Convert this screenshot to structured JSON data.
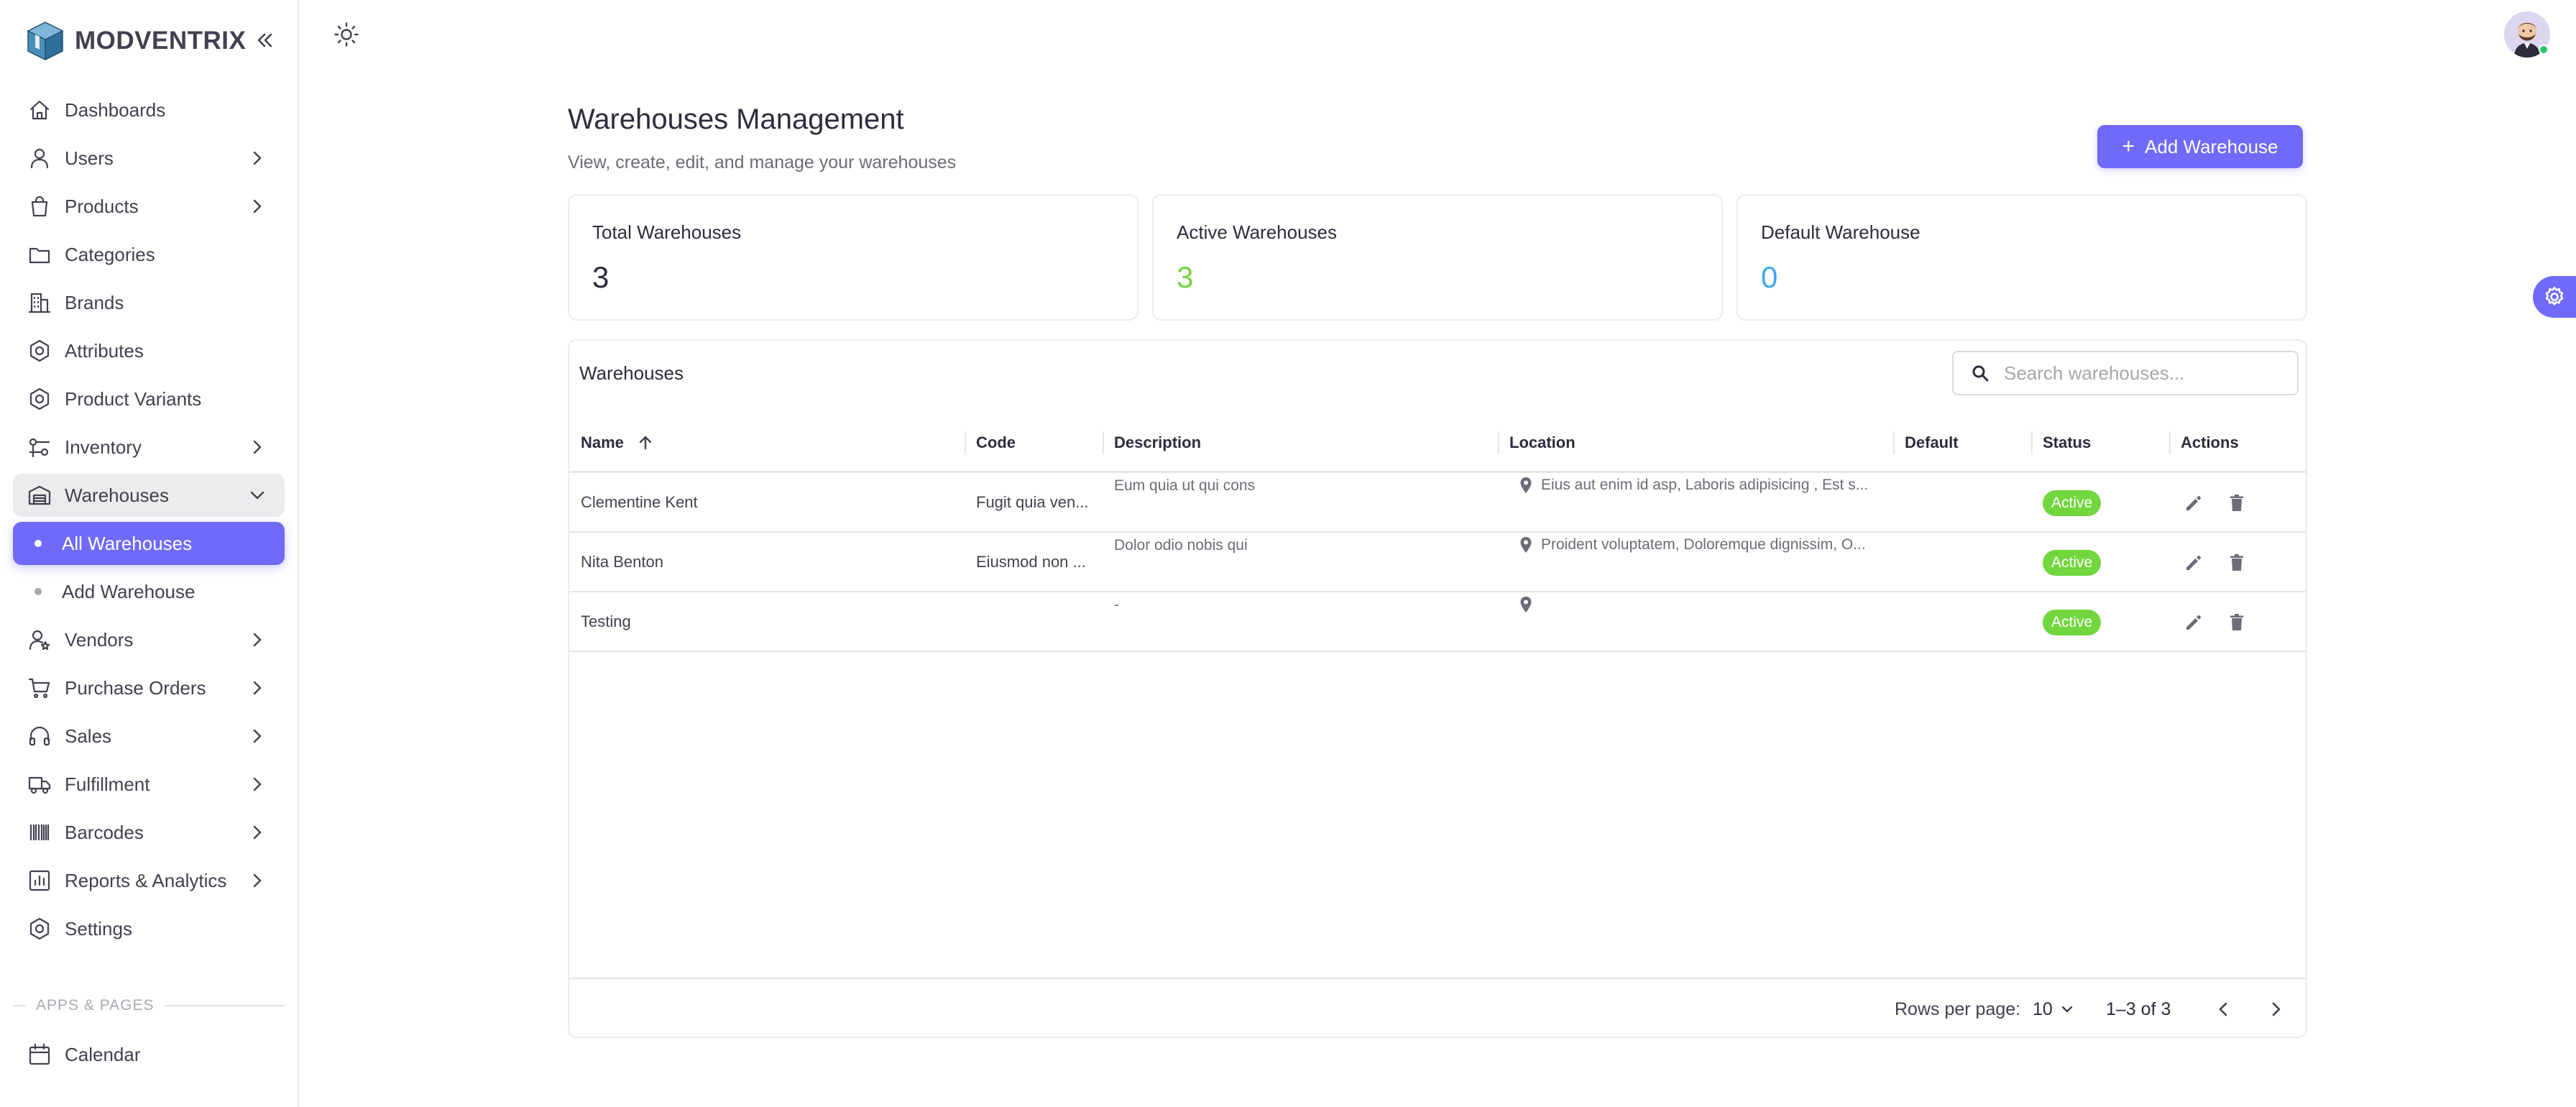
{
  "app": {
    "brand": "MODVENTRIX"
  },
  "sidebar": {
    "items": [
      {
        "label": "Dashboards",
        "icon": "home-icon"
      },
      {
        "label": "Users",
        "icon": "user-icon",
        "chevron": true
      },
      {
        "label": "Products",
        "icon": "shopping-bag-icon",
        "chevron": true
      },
      {
        "label": "Categories",
        "icon": "folder-icon"
      },
      {
        "label": "Brands",
        "icon": "building-icon"
      },
      {
        "label": "Attributes",
        "icon": "hexagon-cog-icon"
      },
      {
        "label": "Product Variants",
        "icon": "hexagon-cog-icon"
      },
      {
        "label": "Inventory",
        "icon": "inventory-icon",
        "chevron": true
      },
      {
        "label": "Warehouses",
        "icon": "warehouse-icon",
        "open": true
      },
      {
        "label": "All Warehouses",
        "sub": true,
        "active": true
      },
      {
        "label": "Add Warehouse",
        "sub": true
      },
      {
        "label": "Vendors",
        "icon": "user-star-icon",
        "chevron": true
      },
      {
        "label": "Purchase Orders",
        "icon": "shopping-cart-icon",
        "chevron": true
      },
      {
        "label": "Sales",
        "icon": "headphones-icon",
        "chevron": true
      },
      {
        "label": "Fulfillment",
        "icon": "truck-icon",
        "chevron": true
      },
      {
        "label": "Barcodes",
        "icon": "barcode-icon",
        "chevron": true
      },
      {
        "label": "Reports & Analytics",
        "icon": "chart-icon",
        "chevron": true
      },
      {
        "label": "Settings",
        "icon": "settings-icon"
      }
    ],
    "section_label": "APPS & PAGES",
    "bottom_items": [
      {
        "label": "Calendar",
        "icon": "calendar-icon"
      }
    ]
  },
  "header": {
    "title": "Warehouses Management",
    "subtitle": "View, create, edit, and manage your warehouses",
    "add_button_label": "Add Warehouse"
  },
  "stats": [
    {
      "label": "Total Warehouses",
      "value": "3",
      "color": "#2f2b3d"
    },
    {
      "label": "Active Warehouses",
      "value": "3",
      "color": "#72d63e"
    },
    {
      "label": "Default Warehouse",
      "value": "0",
      "color": "#3fa9f5"
    }
  ],
  "table": {
    "title": "Warehouses",
    "search_placeholder": "Search warehouses...",
    "columns": [
      "Name",
      "Code",
      "Description",
      "Location",
      "Default",
      "Status",
      "Actions"
    ],
    "rows": [
      {
        "name": "Clementine Kent",
        "code": "Fugit quia ven...",
        "description": "Eum quia ut qui cons",
        "location": "Eius aut enim id asp, Laboris adipisicing , Est s...",
        "default": "",
        "status": "Active"
      },
      {
        "name": "Nita Benton",
        "code": "Eiusmod non ...",
        "description": "Dolor odio nobis qui",
        "location": "Proident voluptatem, Doloremque dignissim, O...",
        "default": "",
        "status": "Active"
      },
      {
        "name": "Testing",
        "code": "",
        "description": "-",
        "location": "",
        "default": "",
        "status": "Active"
      }
    ],
    "footer": {
      "rows_per_page_label": "Rows per page:",
      "rows_per_page": "10",
      "range": "1–3 of 3"
    }
  },
  "colors": {
    "primary": "#6f6af8",
    "active_badge": "#72d63e",
    "info": "#3fa9f5"
  }
}
